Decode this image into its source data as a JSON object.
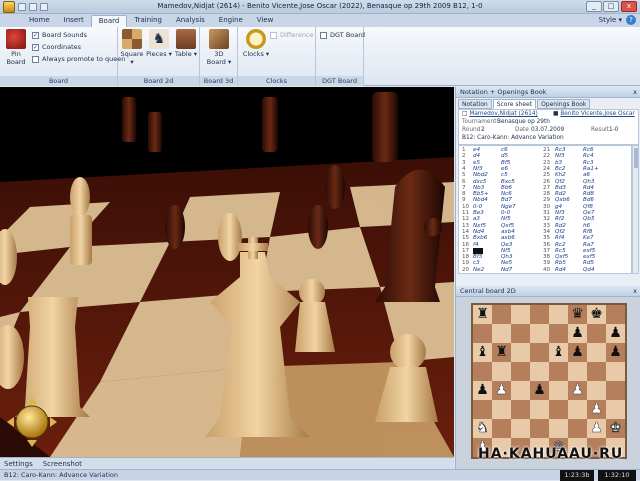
{
  "window": {
    "title": "Mamedov,Nidjat (2614) - Benito Vicente,Jose Oscar (2022), Benasque op 29th 2009  B12, 1-0",
    "min": "_",
    "max": "□",
    "close": "x"
  },
  "ribbon_tabs": [
    "Home",
    "Insert",
    "Board",
    "Training",
    "Analysis",
    "Engine",
    "View"
  ],
  "style_menu": "Style ▾",
  "help": "?",
  "ribbon": {
    "board_group": {
      "pin_board": "Pin Board",
      "board_sounds": "Board Sounds",
      "coordinates": "Coordinates",
      "always_promote": "Always promote to queen",
      "label": "Board"
    },
    "board2d_group": {
      "square": "Square ▾",
      "pieces": "Pieces ▾",
      "table": "Table ▾",
      "label": "Board 2d"
    },
    "board3d_group": {
      "board_3d": "3D Board ▾",
      "label": "Board 3d"
    },
    "clocks_group": {
      "clocks": "Clocks ▾",
      "difference": "Difference",
      "label": "Clocks"
    },
    "dgt_group": {
      "dgt_board": "DGT Board",
      "label": "DGT Board"
    }
  },
  "bottom_tabs": {
    "settings": "Settings",
    "screenshot": "Screenshot"
  },
  "status": {
    "text": "B12: Caro-Kann: Advance Variation",
    "clock_white": "1:23:3b",
    "clock_black": "1:32:10"
  },
  "right_panel": {
    "notation_title": "Notation + Openings Book",
    "close": "x",
    "tabs": [
      "Notation",
      "Score sheet",
      "Openings Book"
    ],
    "header": {
      "white_player": "Mamedov,Nidjat (2614)",
      "black_player": "Benito Vicente,Jose Oscar",
      "tournament_label": "Tournament",
      "tournament": "Benasque op 29th",
      "round_label": "Round",
      "round": "2",
      "date_label": "Date",
      "date": "03.07.2009",
      "result_label": "Result",
      "result": "1-0",
      "eco": "B12: Caro-Kann: Advance Variation"
    },
    "moves": [
      [
        "1",
        "e4",
        "c6",
        "21",
        "Rc3",
        "Rc6"
      ],
      [
        "2",
        "d4",
        "d5",
        "22",
        "Nf3",
        "Rc4"
      ],
      [
        "3",
        "e5",
        "Bf5",
        "23",
        "b3",
        "Rc3"
      ],
      [
        "4",
        "Nf3",
        "e6",
        "24",
        "Bc2",
        "Ra1+"
      ],
      [
        "5",
        "Nbd2",
        "c5",
        "25",
        "Kh2",
        "a6"
      ],
      [
        "6",
        "dxc5",
        "Bxc5",
        "26",
        "Qf2",
        "Qh3"
      ],
      [
        "7",
        "Nb3",
        "Bb6",
        "27",
        "Bd3",
        "Rd4"
      ],
      [
        "8",
        "Bb5+",
        "Nc6",
        "28",
        "Rd2",
        "Rd8"
      ],
      [
        "9",
        "Nbd4",
        "Bd7",
        "29",
        "Qxb6",
        "Bd6"
      ],
      [
        "10",
        "0-0",
        "Nge7",
        "30",
        "g4",
        "Qf8"
      ],
      [
        "11",
        "Be3",
        "0-0",
        "31",
        "Nf3",
        "Qe7"
      ],
      [
        "12",
        "a3",
        "Nf5",
        "32",
        "Rf2",
        "Qb5"
      ],
      [
        "13",
        "Nxf5",
        "Qxf5",
        "33",
        "Rd2",
        "h6"
      ],
      [
        "14",
        "Nd4",
        "axb4",
        "34",
        "Qf2",
        "Rf8"
      ],
      [
        "15",
        "Bxb6",
        "axb6",
        "35",
        "Rf4",
        "Ke7"
      ],
      [
        "16",
        "f4",
        "Qe3",
        "36",
        "Rc2",
        "Ra7"
      ],
      [
        "17",
        "Bc2",
        "Nf5",
        "37",
        "Rc5",
        "exf5"
      ],
      [
        "18",
        "Bf3",
        "Qh3",
        "38",
        "Qxf5",
        "exf5"
      ],
      [
        "19",
        "c3",
        "Ne5",
        "39",
        "Rb5",
        "Rd5"
      ],
      [
        "20",
        "Ne2",
        "Nd7",
        "40",
        "Rd4",
        "Qd4"
      ]
    ],
    "board_title": "Central board 2D",
    "board_position": [
      "r . . . . q k .",
      ". . . . . p . p",
      "b r . . b p . p",
      ". . . . . . . .",
      "p P . p . P . .",
      ". . . . . . P .",
      "N . . . . . P K",
      "P . . . Q . . ."
    ]
  },
  "watermark": "HA·KAHUAAU·RU"
}
